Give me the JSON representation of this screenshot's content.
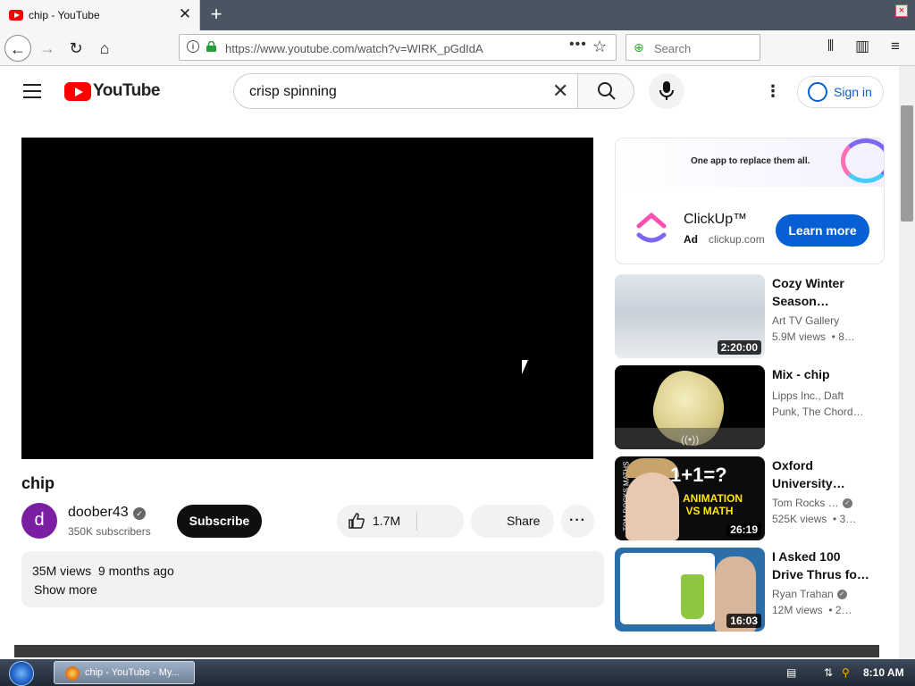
{
  "browser": {
    "tab_title": "chip - YouTube",
    "tab_close": "✕",
    "new_tab": "+",
    "url": "https://www.youtube.com/watch?v=WIRK_pGdIdA",
    "search_placeholder": "Search",
    "url_more": "•••"
  },
  "youtube": {
    "logo_text": "YouTube",
    "search_query": "crisp spinning",
    "signin_label": "Sign in"
  },
  "video": {
    "title": "chip",
    "channel_initial": "d",
    "channel_name": "doober43",
    "subscribers": "350K subscribers",
    "subscribe_label": "Subscribe",
    "likes": "1.7M",
    "share_label": "Share",
    "meta": "35M views  9 months ago",
    "show_more": "Show more"
  },
  "ad": {
    "tagline": "One app to replace them all.",
    "name": "ClickUp™",
    "ad_label": "Ad",
    "domain": "clickup.com",
    "cta": "Learn more"
  },
  "recommendations": [
    {
      "title": "Cozy Winter Season…",
      "channel": "Art TV Gallery",
      "views": "5.9M views  • 8…",
      "duration": "2:20:00",
      "verified": false
    },
    {
      "title": "Mix - chip",
      "channel": "Lipps Inc., Daft Punk, The Chord…",
      "views": "",
      "duration": "",
      "verified": false
    },
    {
      "title": "Oxford University…",
      "channel": "Tom Rocks …",
      "views": "525K views  • 3…",
      "duration": "26:19",
      "verified": true
    },
    {
      "title": "I Asked 100 Drive Thrus fo…",
      "channel": "Ryan Trahan",
      "views": "12M views  • 2…",
      "duration": "16:03",
      "verified": true
    }
  ],
  "thumb_text": {
    "math_eq": "1+1=?",
    "math_sub": "ANIMATION VS MATH",
    "math_side": "TOM ROCKS MATHS",
    "live_icon": "((•))"
  },
  "taskbar": {
    "task_label": "chip - YouTube - My...",
    "clock": "8:10 AM"
  },
  "colors": {
    "youtube_red": "#ff0000",
    "link_blue": "#065fd4",
    "subscribe_bg": "#0f0f0f"
  }
}
